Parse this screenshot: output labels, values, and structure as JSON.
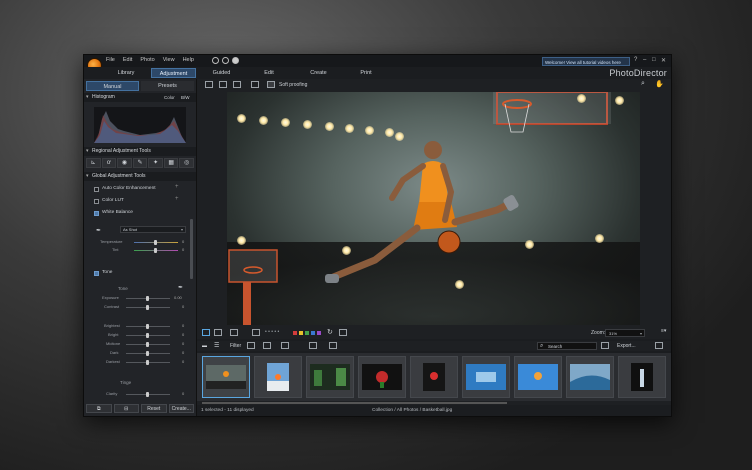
{
  "menu": [
    "File",
    "Edit",
    "Photo",
    "View",
    "Help"
  ],
  "welcome_text": "Welcome! View all tutorial videos here",
  "window_controls": [
    "?",
    "–",
    "□",
    "✕"
  ],
  "modes": [
    "Library",
    "Adjustment",
    "Guided",
    "Edit",
    "Create",
    "Print"
  ],
  "active_mode": "Adjustment",
  "brand": "PhotoDirector",
  "left_panel": {
    "tabs": [
      "Manual",
      "Presets"
    ],
    "histogram": {
      "title": "Histogram",
      "color": "Color",
      "bw": "B/W"
    },
    "regional_title": "Regional Adjustment Tools",
    "global_title": "Global Adjustment Tools",
    "auto_color": "Auto Color Enhancement",
    "color_lut": "Color LUT",
    "white_balance": "White Balance",
    "wb_preset": "As Shot",
    "temperature": "Temperature",
    "tint": "Tint",
    "temp_val": "0",
    "tint_val": "0",
    "tone_section": "Tone",
    "tone_sub": "Tone",
    "exposure": "Exposure",
    "exposure_val": "0.00",
    "contrast": "Contrast",
    "contrast_val": "0",
    "tone_rows": [
      "Brightest",
      "Bright",
      "Midtone",
      "Dark",
      "Darkest"
    ],
    "tone_vals": [
      "0",
      "0",
      "0",
      "0",
      "0"
    ],
    "tinge": "Tinge",
    "clarity": "Clarity",
    "clarity_val": "0",
    "buttons": [
      "Reset",
      "Create..."
    ]
  },
  "toolbar": {
    "soft_proofing": "Soft proofing"
  },
  "filmstrip": {
    "filter_label": "Filter",
    "search_placeholder": "Search",
    "zoom_label": "Zoom:",
    "zoom_value": "31%",
    "export_label": "Export..."
  },
  "status": {
    "left": "1 selected - 11 displayed",
    "path": "Collection / All Photos / Basketball.jpg"
  },
  "colors": {
    "accent": "#2d4868",
    "selected_border": "#5aa6e0"
  }
}
